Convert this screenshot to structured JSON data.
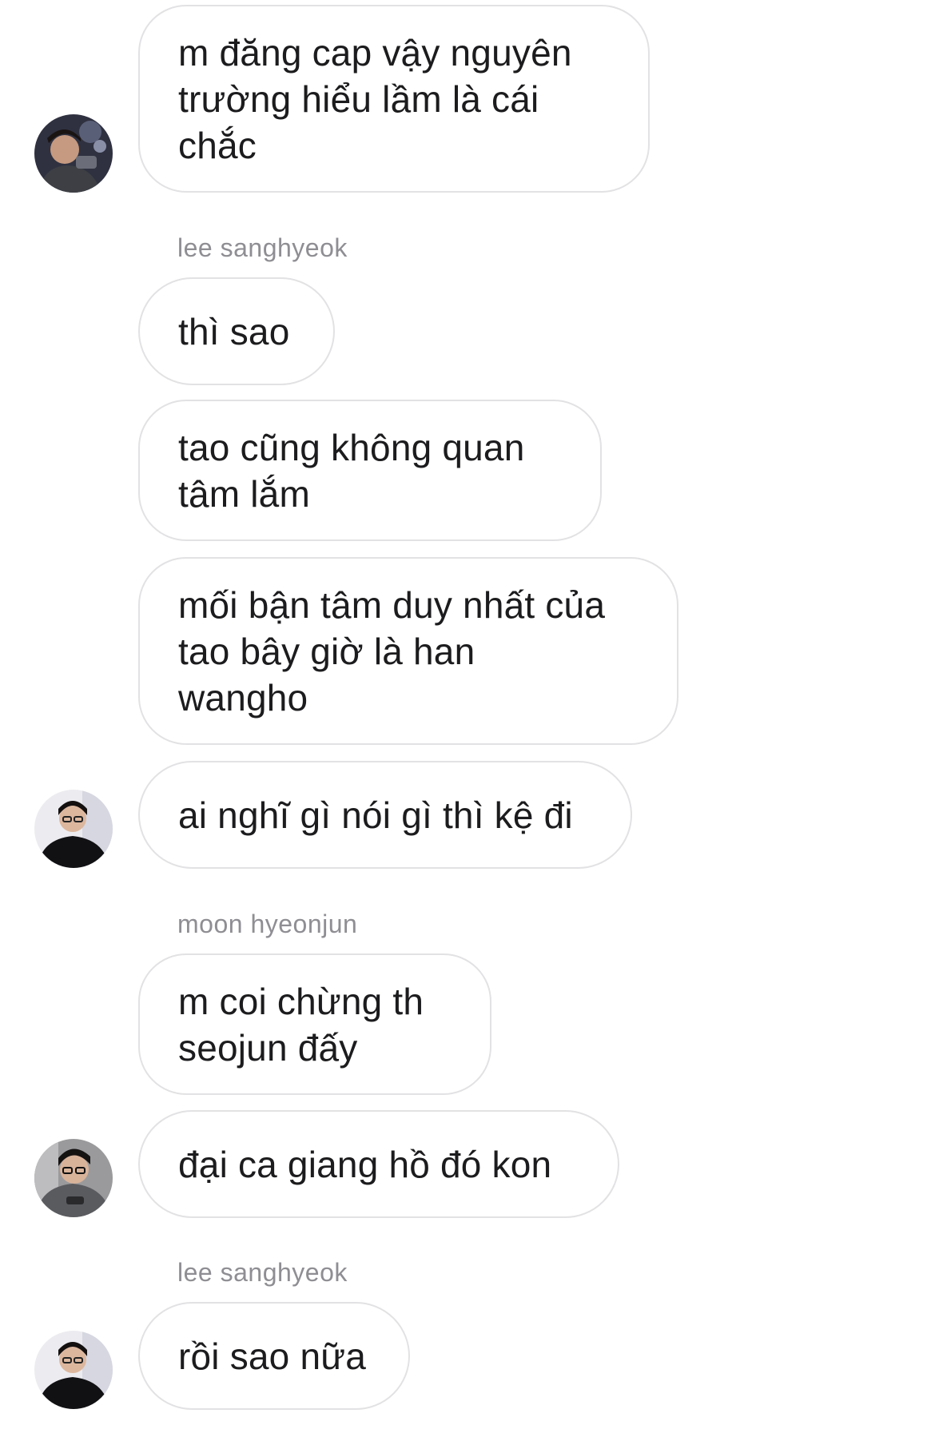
{
  "thread": {
    "messages": [
      {
        "sender": "",
        "text": "m đăng cap vậy nguyên\ntrường hiểu lầm là cái\nchắc",
        "avatar": "avatar-photo-1"
      },
      {
        "sender": "lee sanghyeok",
        "text": "thì sao",
        "avatar": ""
      },
      {
        "sender": "",
        "text": "tao cũng không quan\ntâm lắm",
        "avatar": ""
      },
      {
        "sender": "",
        "text": "mối bận tâm duy nhất của\ntao bây giờ là han\nwangho",
        "avatar": ""
      },
      {
        "sender": "",
        "text": "ai nghĩ gì nói gì thì kệ đi",
        "avatar": "avatar-photo-2"
      },
      {
        "sender": "moon hyeonjun",
        "text": "m coi chừng th\nseojun đấy",
        "avatar": ""
      },
      {
        "sender": "",
        "text": "đại ca giang hồ đó kon",
        "avatar": "avatar-photo-3"
      },
      {
        "sender": "lee sanghyeok",
        "text": "rồi sao nữa",
        "avatar": "avatar-photo-2"
      }
    ]
  },
  "colors": {
    "bubble_border": "#e2e2e4",
    "sender_text": "#8e8e93",
    "message_text": "#1c1c1e",
    "background": "#ffffff"
  }
}
